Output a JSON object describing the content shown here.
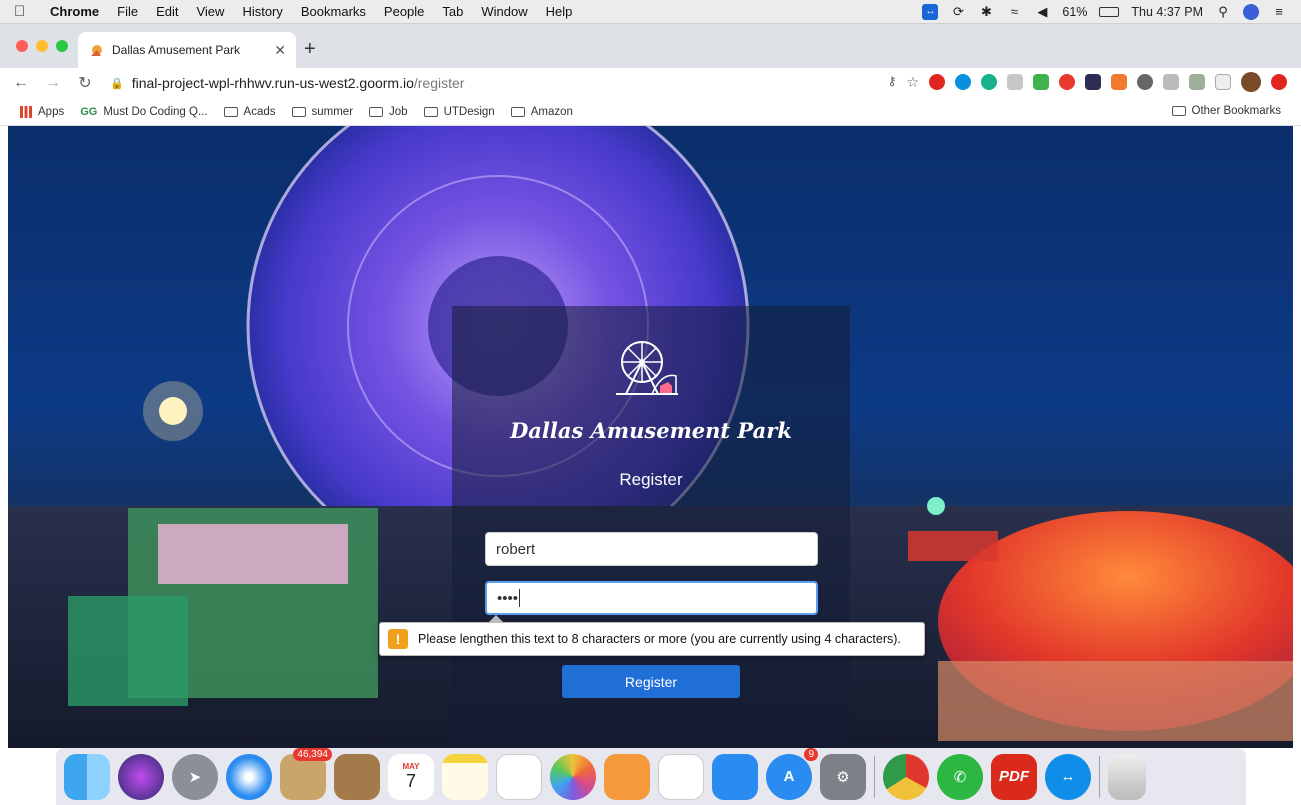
{
  "menubar": {
    "app": "Chrome",
    "items": [
      "File",
      "Edit",
      "View",
      "History",
      "Bookmarks",
      "People",
      "Tab",
      "Window",
      "Help"
    ],
    "battery": "61%",
    "clock": "Thu 4:37 PM"
  },
  "tab": {
    "title": "Dallas Amusement Park"
  },
  "address": {
    "host": "final-project-wpl-rhhwv.run-us-west2.goorm.io",
    "path": "/register"
  },
  "bookmarks": {
    "apps": "Apps",
    "items": [
      "Must Do Coding Q...",
      "Acads",
      "summer",
      "Job",
      "UTDesign",
      "Amazon"
    ],
    "other": "Other Bookmarks"
  },
  "page": {
    "brand": "Dallas Amusement Park",
    "heading": "Register",
    "username_value": "robert",
    "password_mask": "••••",
    "tooltip": "Please lengthen this text to 8 characters or more (you are currently using 4 characters).",
    "submit_label": "Register"
  },
  "dock": {
    "mail_badge": "46,394",
    "calendar_month": "MAY",
    "calendar_day": "7",
    "appstore_badge": "9",
    "pdf_label": "PDF"
  }
}
